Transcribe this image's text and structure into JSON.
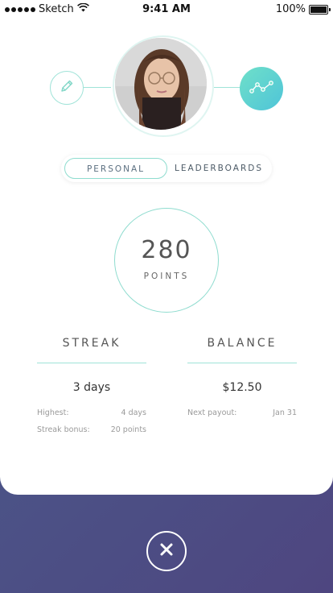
{
  "status_bar": {
    "carrier": "Sketch",
    "time": "9:41 AM",
    "battery": "100%"
  },
  "profile": {
    "edit_icon": "pencil-icon",
    "stats_icon": "line-chart-icon"
  },
  "tabs": [
    {
      "label": "PERSONAL",
      "active": true
    },
    {
      "label": "LEADERBOARDS",
      "active": false
    }
  ],
  "points": {
    "value": "280",
    "label": "POINTS"
  },
  "streak": {
    "title": "STREAK",
    "value": "3 days",
    "details": [
      {
        "label": "Highest:",
        "value": "4 days"
      },
      {
        "label": "Streak bonus:",
        "value": "20 points"
      }
    ]
  },
  "balance": {
    "title": "BALANCE",
    "value": "$12.50",
    "details": [
      {
        "label": "Next payout:",
        "value": "Jan 31"
      }
    ]
  },
  "colors": {
    "accent": "#8fdccf",
    "gradient_start": "#6fe0c9",
    "gradient_end": "#4fc4d8",
    "background": "#4b5387"
  }
}
